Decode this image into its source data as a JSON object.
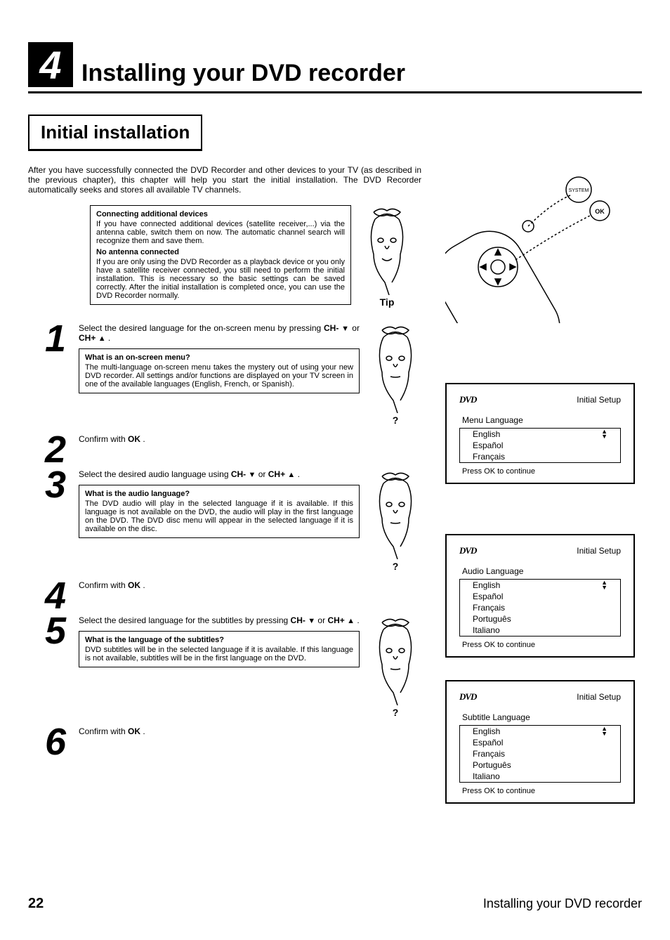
{
  "chapter": {
    "number": "4",
    "title": "Installing your DVD recorder"
  },
  "section": {
    "title": "Initial installation"
  },
  "intro": "After you have successfully connected the DVD Recorder and other devices to your TV (as described in the previous chapter), this chapter will help you start the initial installation. The DVD Recorder automatically seeks and stores all available TV channels.",
  "tipbox": {
    "h1": "Connecting additional devices",
    "p1": "If you have connected additional devices (satellite receiver,...) via the antenna cable, switch them on now. The automatic channel search will recognize them and save them.",
    "h2": "No antenna connected",
    "p2": "If you are only using the DVD Recorder as a playback device or you only have a satellite receiver connected, you still need to perform the initial installation. This is necessary so the basic settings can be saved correctly. After the initial installation is completed once, you can use the DVD Recorder normally.",
    "label": "Tip"
  },
  "steps": {
    "s1": {
      "num": "1",
      "text_a": "Select the desired language for the on-screen menu by pressing ",
      "ch_minus": "CH-",
      "or": " or ",
      "ch_plus": "CH+",
      "dot": " .",
      "qtitle": "What is an on-screen menu?",
      "qbody": "The multi-language on-screen menu takes the mystery out of using your new DVD recorder. All settings and/or functions are displayed on your TV screen in one of the available languages (English, French, or Spanish).",
      "qmark": "?"
    },
    "s2": {
      "num": "2",
      "text": "Confirm with ",
      "ok": "OK",
      "dot": " ."
    },
    "s3": {
      "num": "3",
      "text": "Select the desired audio language using ",
      "ch_minus": "CH-",
      "or": " or ",
      "ch_plus": "CH+",
      "dot": " .",
      "qtitle": "What is the audio language?",
      "qbody": "The DVD audio will play in the selected language if it is available. If this language is not available on the DVD, the audio will play in the first language on the DVD. The DVD disc menu will appear in the selected language if it is available on the disc.",
      "qmark": "?"
    },
    "s4": {
      "num": "4",
      "text": "Confirm with ",
      "ok": "OK",
      "dot": " ."
    },
    "s5": {
      "num": "5",
      "text": "Select the desired language for the subtitles by pressing ",
      "ch_minus": "CH-",
      "or": " or ",
      "ch_plus": "CH+",
      "dot": " .",
      "qtitle": "What is the language of the subtitles?",
      "qbody": "DVD subtitles will be in the selected language if it is available. If this language is not available, subtitles will be in the first language on the DVD.",
      "qmark": "?"
    },
    "s6": {
      "num": "6",
      "text": "Confirm with ",
      "ok": "OK",
      "dot": " ."
    }
  },
  "osd": {
    "logo": "DVD",
    "setup": "Initial Setup",
    "continue": "Press OK to continue",
    "menu1": {
      "title": "Menu Language",
      "items": [
        "English",
        "Español",
        "Français"
      ]
    },
    "menu2": {
      "title": "Audio Language",
      "items": [
        "English",
        "Español",
        "Français",
        "Português",
        "Italiano"
      ]
    },
    "menu3": {
      "title": "Subtitle Language",
      "items": [
        "English",
        "Español",
        "Français",
        "Português",
        "Italiano"
      ]
    }
  },
  "remote": {
    "system": "SYSTEM",
    "ok": "OK"
  },
  "footer": {
    "page": "22",
    "title": "Installing your DVD recorder"
  }
}
